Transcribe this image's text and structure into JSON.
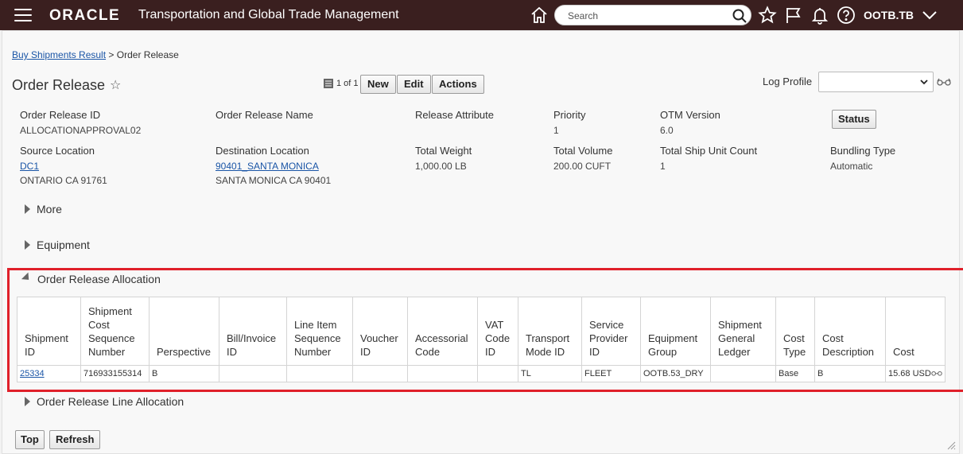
{
  "header": {
    "brand": "ORACLE",
    "app_title": "Transportation and Global Trade Management",
    "search_placeholder": "Search",
    "user": "OOTB.TB"
  },
  "breadcrumb": {
    "parent": "Buy Shipments Result",
    "separator": ">",
    "current": "Order Release"
  },
  "page": {
    "title": "Order Release",
    "pager": "1 of 1",
    "buttons": {
      "new": "New",
      "edit": "Edit",
      "actions": "Actions"
    },
    "log_profile_label": "Log Profile",
    "log_profile_value": "",
    "status_button": "Status"
  },
  "fields": {
    "order_release_id": {
      "label": "Order Release ID",
      "value": "ALLOCATIONAPPROVAL02"
    },
    "order_release_name": {
      "label": "Order Release Name",
      "value": ""
    },
    "release_attribute": {
      "label": "Release Attribute",
      "value": ""
    },
    "priority": {
      "label": "Priority",
      "value": "1"
    },
    "otm_version": {
      "label": "OTM Version",
      "value": "6.0"
    },
    "source_location": {
      "label": "Source Location",
      "link": "DC1",
      "address": "ONTARIO CA 91761"
    },
    "destination_location": {
      "label": "Destination Location",
      "link": "90401_SANTA MONICA",
      "address": "SANTA MONICA CA 90401"
    },
    "total_weight": {
      "label": "Total Weight",
      "value": "1,000.00 LB"
    },
    "total_volume": {
      "label": "Total Volume",
      "value": "200.00 CUFT"
    },
    "total_ship_unit_count": {
      "label": "Total Ship Unit Count",
      "value": "1"
    },
    "bundling_type": {
      "label": "Bundling Type",
      "value": "Automatic"
    }
  },
  "sections": {
    "more": "More",
    "equipment": "Equipment",
    "allocation": "Order Release Allocation",
    "line_allocation": "Order Release Line Allocation"
  },
  "allocation_table": {
    "headers": [
      [
        "Shipment",
        "ID"
      ],
      [
        "Shipment",
        "Cost",
        "Sequence",
        "Number"
      ],
      [
        "Perspective"
      ],
      [
        "Bill/Invoice",
        "ID"
      ],
      [
        "Line Item",
        "Sequence",
        "Number"
      ],
      [
        "Voucher",
        "ID"
      ],
      [
        "Accessorial",
        "Code"
      ],
      [
        "VAT",
        "Code",
        "ID"
      ],
      [
        "Transport",
        "Mode ID"
      ],
      [
        "Service",
        "Provider",
        "ID"
      ],
      [
        "Equipment",
        "Group"
      ],
      [
        "Shipment",
        "General",
        "Ledger"
      ],
      [
        "Cost",
        "Type"
      ],
      [
        "Cost",
        "Description"
      ],
      [
        "Cost"
      ]
    ],
    "rows": [
      [
        "25334",
        "716933155314",
        "B",
        "",
        "",
        "",
        "",
        "",
        "TL",
        "FLEET",
        "OOTB.53_DRY",
        "",
        "Base",
        "B",
        "15.68 USD"
      ]
    ]
  },
  "footer_buttons": {
    "top": "Top",
    "refresh": "Refresh"
  }
}
